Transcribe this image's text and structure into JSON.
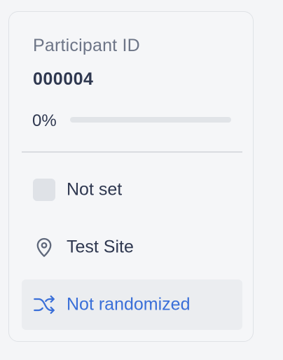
{
  "participant": {
    "id_label": "Participant ID",
    "id_value": "000004"
  },
  "progress": {
    "text": "0%",
    "value": 0
  },
  "items": {
    "status": {
      "label": "Not set",
      "icon": "status-swatch-icon"
    },
    "site": {
      "label": "Test Site",
      "icon": "map-pin-icon"
    },
    "randomization": {
      "label": "Not randomized",
      "icon": "shuffle-icon"
    }
  },
  "colors": {
    "accent": "#3a6fd8",
    "text": "#2f3850",
    "muted": "#6d7587",
    "track": "#e1e4e8"
  }
}
